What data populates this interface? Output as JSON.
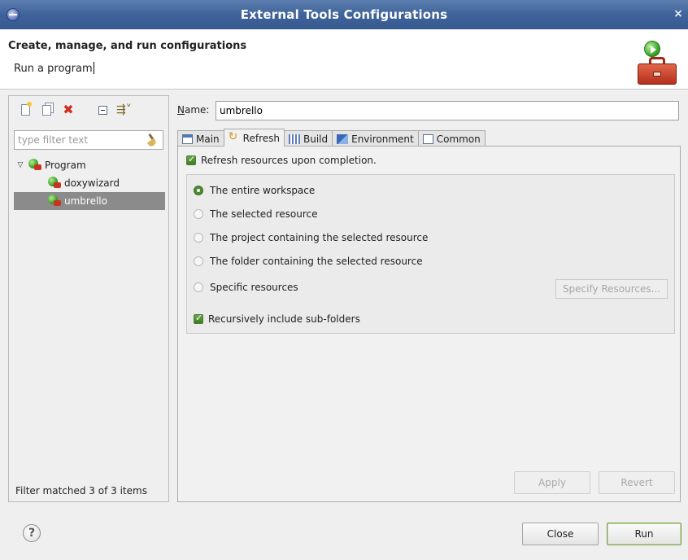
{
  "window": {
    "title": "External Tools Configurations",
    "close_glyph": "×"
  },
  "banner": {
    "title": "Create, manage, and run configurations",
    "message": "Run a program"
  },
  "left": {
    "filter_placeholder": "type filter text",
    "tree": [
      {
        "label": "Program"
      },
      {
        "label": "doxywizard"
      },
      {
        "label": "umbrello"
      }
    ],
    "status": "Filter matched 3 of 3 items"
  },
  "main": {
    "name_label": "Name:",
    "name_mnemonic": "N",
    "name_rest": "ame:",
    "name_value": "umbrello",
    "tabs": [
      {
        "label": "Main"
      },
      {
        "label": "Refresh"
      },
      {
        "label": "Build"
      },
      {
        "label": "Environment"
      },
      {
        "label": "Common"
      }
    ],
    "refresh": {
      "refresh_checkbox": "Refresh resources upon completion.",
      "radios": [
        "The entire workspace",
        "The selected resource",
        "The project containing the selected resource",
        "The folder containing the selected resource",
        "Specific resources"
      ],
      "selected_radio": "The entire workspace",
      "specify_button": "Specify Resources...",
      "recursive_checkbox": "Recursively include sub-folders"
    },
    "apply_label": "Apply",
    "revert_label": "Revert"
  },
  "footer": {
    "close_label": "Close",
    "run_label": "Run",
    "help_glyph": "?"
  },
  "colors": {
    "titlebar": "#3f639a",
    "selection": "#8b8b8b",
    "checkbox": "#4c8b30"
  }
}
